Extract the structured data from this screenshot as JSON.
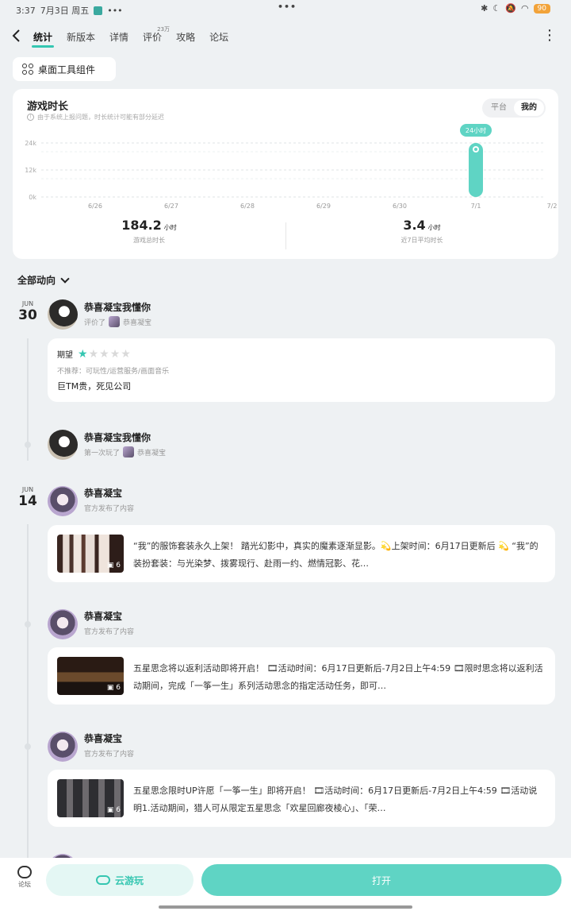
{
  "status": {
    "time": "3:37",
    "date": "7月3日 周五",
    "dots": "•••",
    "battery": "90"
  },
  "nav": {
    "tabs": [
      {
        "label": "统计",
        "active": true
      },
      {
        "label": "新版本"
      },
      {
        "label": "详情"
      },
      {
        "label": "评价",
        "badge": "23万"
      },
      {
        "label": "攻略"
      },
      {
        "label": "论坛"
      }
    ]
  },
  "widget": {
    "label": "桌面工具组件"
  },
  "stats": {
    "title": "游戏时长",
    "subtitle": "由于系统上报问题，时长统计可能有部分延迟",
    "toggle": [
      "平台",
      "我的"
    ],
    "total_value": "184.2",
    "total_unit": "小时",
    "total_label": "游戏总时长",
    "avg_value": "3.4",
    "avg_unit": "小时",
    "avg_label": "近7日平均时长"
  },
  "chart_data": {
    "type": "bar",
    "categories": [
      "6/26",
      "6/27",
      "6/28",
      "6/29",
      "6/30",
      "7/1",
      "7/2"
    ],
    "values": [
      0,
      0,
      0,
      0,
      0,
      24,
      0
    ],
    "yticks": [
      "24k",
      "12k",
      "0k"
    ],
    "ylim": [
      0,
      24
    ],
    "bubble_label": "24小时",
    "accent": "#5fd4c4",
    "grid": true
  },
  "filter": {
    "label": "全部动向"
  },
  "feed": [
    {
      "month": "JUN",
      "day": "30",
      "name": "恭喜凝宝我懂你",
      "action": "评价了",
      "target": "恭喜凝宝",
      "review_title": "期望",
      "rating": 1,
      "max_rating": 5,
      "tags": "不推荐：可玩性/运营服务/画面音乐",
      "text": "巨TM贵，死见公司"
    },
    {
      "name": "恭喜凝宝我懂你",
      "action": "第一次玩了",
      "target": "恭喜凝宝"
    },
    {
      "month": "JUN",
      "day": "14",
      "name": "恭喜凝宝",
      "action": "官方发布了内容",
      "text": "“我”的服饰套装永久上架！ 踏光幻影中，真实的魔素逐渐显影。💫上架时间：6月17日更新后 💫 “我”的装扮套装：与光染梦、拨雾现行、赴雨一约、燃情冠影、花…",
      "image_count": "6"
    },
    {
      "name": "恭喜凝宝",
      "action": "官方发布了内容",
      "text": "五星思念将以返利活动即将开启！ 🎞活动时间：6月17日更新后-7月2日上午4:59 🎞限时思念将以返利活动期间，完成「一筝一生」系列活动思念的指定活动任务，即可…",
      "image_count": "6"
    },
    {
      "name": "恭喜凝宝",
      "action": "官方发布了内容",
      "text": "五星思念限时UP许愿「一筝一生」即将开启！ 🎞活动时间：6月17日更新后-7月2日上午4:59 🎞活动说明1.活动期间，猎人可从限定五星思念「欢星回廊夜棱心」、「荣…",
      "image_count": "6"
    }
  ],
  "bottom": {
    "forum": "论坛",
    "cloud": "云游玩",
    "open": "打开"
  }
}
